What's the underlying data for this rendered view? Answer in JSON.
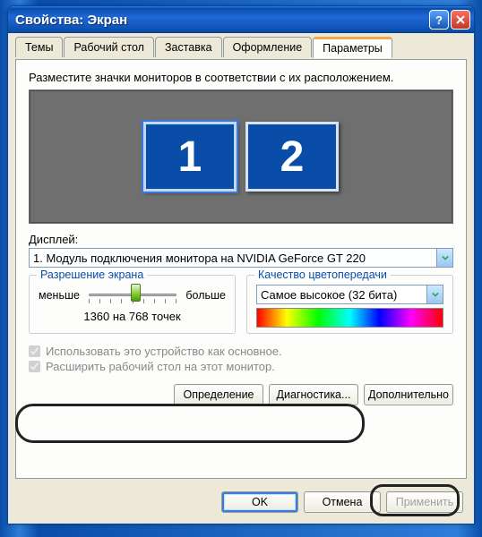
{
  "window": {
    "title": "Свойства: Экран"
  },
  "tabs": [
    "Темы",
    "Рабочий стол",
    "Заставка",
    "Оформление",
    "Параметры"
  ],
  "active_tab_index": 4,
  "params": {
    "instruction": "Разместите значки мониторов в соответствии с их расположением.",
    "monitors": [
      {
        "id": "1",
        "selected": true
      },
      {
        "id": "2",
        "selected": false
      }
    ],
    "display_label": "Дисплей:",
    "display_value": "1. Модуль подключения монитора на NVIDIA GeForce GT 220",
    "resolution": {
      "legend": "Разрешение экрана",
      "less": "меньше",
      "more": "больше",
      "text": "1360 на 768 точек"
    },
    "color": {
      "legend": "Качество цветопередачи",
      "value": "Самое высокое (32 бита)"
    },
    "checks": {
      "primary_label": "Использовать это устройство как основное.",
      "primary_checked": true,
      "extend_label": "Расширить рабочий стол на этот монитор.",
      "extend_checked": true
    },
    "buttons": {
      "identify": "Определение",
      "troubleshoot": "Диагностика...",
      "advanced": "Дополнительно"
    }
  },
  "footer": {
    "ok": "OK",
    "cancel": "Отмена",
    "apply": "Применить"
  }
}
